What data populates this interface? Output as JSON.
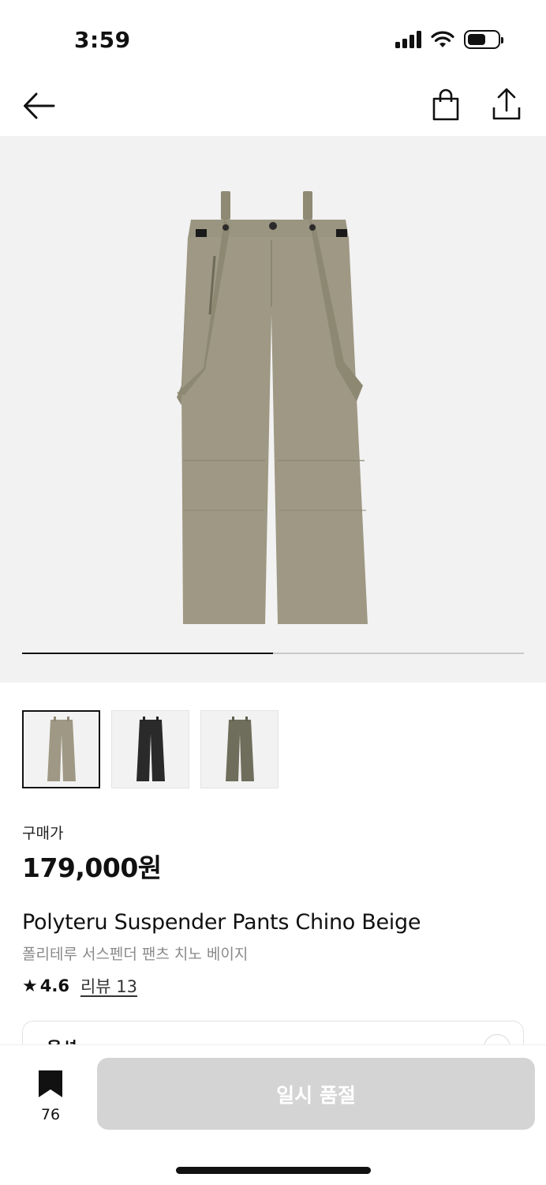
{
  "status_bar": {
    "time": "3:59",
    "icons": [
      "cellular-signal-icon",
      "wifi-icon",
      "battery-icon"
    ],
    "battery_level": 0.6
  },
  "nav": {
    "icons": [
      "back-arrow-icon",
      "shopping-bag-icon",
      "share-icon"
    ]
  },
  "gallery": {
    "image": "beige suspender pants",
    "progress": 0.5,
    "background": "#f2f2f2",
    "thumbnails": [
      {
        "color": "beige",
        "selected": true
      },
      {
        "color": "black",
        "selected": false
      },
      {
        "color": "khaki",
        "selected": false
      }
    ]
  },
  "product": {
    "price_label": "구매가",
    "price": "179,000원",
    "title_en": "Polyteru Suspender Pants Chino Beige",
    "title_ko": "폴리테루 서스펜더 팬츠 치노 베이지",
    "rating": "4.6",
    "review_link": "리뷰 13"
  },
  "option": {
    "label": "옵션"
  },
  "bottom_bar": {
    "bookmark_count": "76",
    "soldout_label": "일시 품절",
    "button_color": "#d4d4d4"
  }
}
